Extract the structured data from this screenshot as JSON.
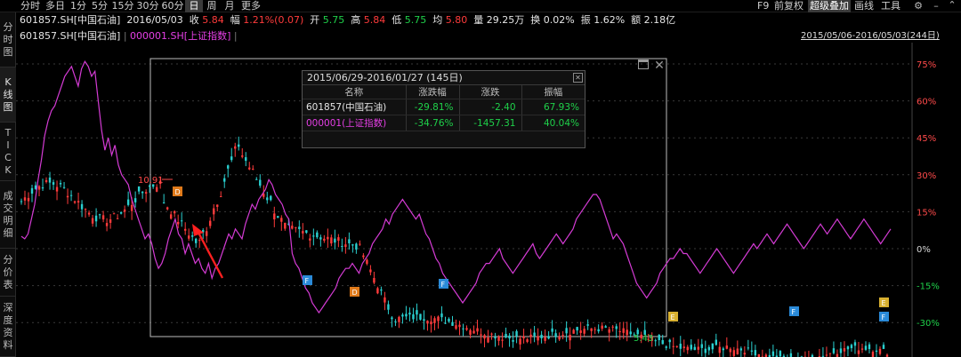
{
  "toolbar": {
    "timeframes": [
      "分时",
      "多日",
      "1分",
      "5分",
      "15分",
      "30分",
      "60分",
      "日",
      "周",
      "月",
      "更多"
    ],
    "active_timeframe": "日",
    "right": [
      "F9",
      "前复权",
      "超级叠加",
      "画线",
      "工具"
    ],
    "active_right": "超级叠加"
  },
  "side_tabs": [
    {
      "label": "分时图",
      "active": false
    },
    {
      "label": "K线图",
      "active": true
    },
    {
      "label": "TICK",
      "active": false
    },
    {
      "label": "成交明细",
      "active": false
    },
    {
      "label": "分价表",
      "active": false
    },
    {
      "label": "深度资料",
      "active": false
    }
  ],
  "quote": {
    "symbol": "601857.SH[中国石油]",
    "date": "2016/05/03",
    "close_label": "收",
    "close": "5.84",
    "change_label": "幅",
    "change": "1.21%(0.07)",
    "open_label": "开",
    "open": "5.75",
    "high_label": "高",
    "high": "5.84",
    "low_label": "低",
    "low": "5.75",
    "avg_label": "均",
    "avg": "5.80",
    "volume_label": "量",
    "volume": "29.25万",
    "turnover_label": "换",
    "turnover": "0.02%",
    "amplitude_label": "振",
    "amplitude": "1.62%",
    "amount_label": "额",
    "amount": "2.18亿"
  },
  "legend": {
    "main": "601857.SH[中国石油]",
    "overlay": "000001.SH[上证指数]",
    "range": "2015/05/06-2016/05/03(244日)"
  },
  "colors": {
    "up": "#ff3b3b",
    "down": "#2ad0d0",
    "overlay": "#d43bd4",
    "text_up": "#ff3b3b",
    "text_down": "#1fd14a"
  },
  "stats_panel": {
    "title": "2015/06/29-2016/01/27 (145日)",
    "headers": [
      "名称",
      "涨跌幅",
      "涨跌",
      "振幅"
    ],
    "rows": [
      {
        "name": "601857(中国石油)",
        "pct": "-29.81%",
        "chg": "-2.40",
        "amp": "67.93%"
      },
      {
        "name": "000001(上证指数)",
        "pct": "-34.76%",
        "chg": "-1457.31",
        "amp": "40.04%"
      }
    ]
  },
  "annotations": {
    "high_price": "10.91",
    "low_price": "5.43"
  },
  "event_markers": [
    "D",
    "F",
    "D",
    "F",
    "E",
    "F",
    "E",
    "F"
  ],
  "chart_data": {
    "type": "line",
    "y_axis_labels": [
      "75%",
      "60%",
      "45%",
      "30%",
      "15%",
      "0%",
      "-15%",
      "-30%"
    ],
    "y_axis_values": [
      75,
      60,
      45,
      30,
      15,
      0,
      -15,
      -30
    ],
    "series": [
      {
        "name": "000001.SH[上证指数]",
        "values": [
          5,
          4,
          6,
          12,
          18,
          28,
          36,
          46,
          52,
          56,
          58,
          62,
          66,
          70,
          72,
          74,
          70,
          66,
          73,
          76,
          74,
          70,
          72,
          60,
          48,
          40,
          45,
          38,
          42,
          34,
          30,
          28,
          26,
          20,
          16,
          12,
          8,
          4,
          6,
          2,
          -4,
          -8,
          -6,
          -2,
          4,
          8,
          12,
          6,
          4,
          -2,
          2,
          -2,
          -6,
          -4,
          -8,
          -10,
          -6,
          -12,
          -8,
          -6,
          -2,
          2,
          6,
          4,
          8,
          6,
          4,
          10,
          14,
          18,
          16,
          20,
          22,
          24,
          28,
          26,
          22,
          20,
          18,
          14,
          12,
          -2,
          -6,
          -8,
          -12,
          -16,
          -18,
          -22,
          -24,
          -26,
          -24,
          -22,
          -20,
          -18,
          -16,
          -12,
          -10,
          -8,
          -8,
          -6,
          -8,
          -10,
          -6,
          -4,
          -2,
          2,
          4,
          6,
          8,
          12,
          10,
          14,
          16,
          18,
          20,
          18,
          16,
          14,
          12,
          14,
          10,
          6,
          4,
          0,
          -4,
          -6,
          -10,
          -12,
          -14,
          -16,
          -18,
          -20,
          -22,
          -20,
          -18,
          -16,
          -14,
          -10,
          -8,
          -6,
          -6,
          -4,
          -2,
          0,
          -4,
          -6,
          -8,
          -10,
          -8,
          -6,
          -4,
          -2,
          0,
          2,
          -2,
          -4,
          -2,
          0,
          2,
          4,
          6,
          4,
          2,
          4,
          6,
          8,
          12,
          14,
          16,
          18,
          20,
          22,
          22,
          20,
          16,
          12,
          8,
          4,
          6,
          4,
          2,
          -2,
          -6,
          -10,
          -14,
          -16,
          -18,
          -20,
          -18,
          -16,
          -14,
          -10,
          -8,
          -6,
          -4,
          -4,
          -2,
          0,
          -2,
          -2,
          -4,
          -6,
          -8,
          -10,
          -8,
          -6,
          -4,
          -2,
          0,
          -2,
          -4,
          -6,
          -8,
          -10,
          -8,
          -6,
          -4,
          -2,
          0,
          2,
          0,
          2,
          4,
          6,
          4,
          2,
          4,
          6,
          8,
          10,
          8,
          6,
          4,
          2,
          0,
          2,
          4,
          6,
          8,
          10,
          8,
          6,
          8,
          10,
          12,
          10,
          8,
          6,
          4,
          6,
          8,
          10,
          12,
          10,
          8,
          6,
          4,
          2,
          4,
          6,
          8
        ]
      }
    ]
  }
}
